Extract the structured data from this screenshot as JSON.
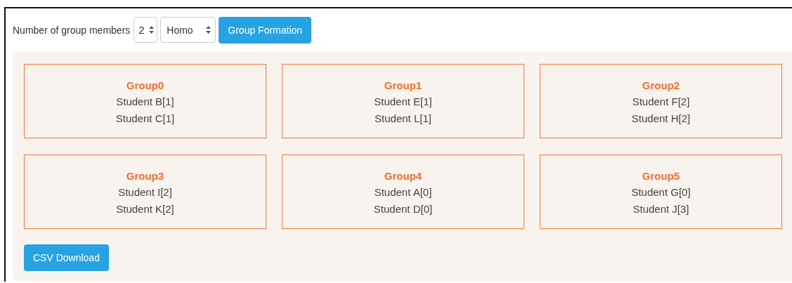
{
  "controls": {
    "label": "Number of group members",
    "members": "2",
    "mode": "Homo",
    "form_button": "Group Formation"
  },
  "groups": [
    {
      "title": "Group0",
      "students": [
        "Student B[1]",
        "Student C[1]"
      ]
    },
    {
      "title": "Group1",
      "students": [
        "Student E[1]",
        "Student L[1]"
      ]
    },
    {
      "title": "Group2",
      "students": [
        "Student F[2]",
        "Student H[2]"
      ]
    },
    {
      "title": "Group3",
      "students": [
        "Student I[2]",
        "Student K[2]"
      ]
    },
    {
      "title": "Group4",
      "students": [
        "Student A[0]",
        "Student D[0]"
      ]
    },
    {
      "title": "Group5",
      "students": [
        "Student G[0]",
        "Student J[3]"
      ]
    }
  ],
  "download_button": "CSV Download"
}
